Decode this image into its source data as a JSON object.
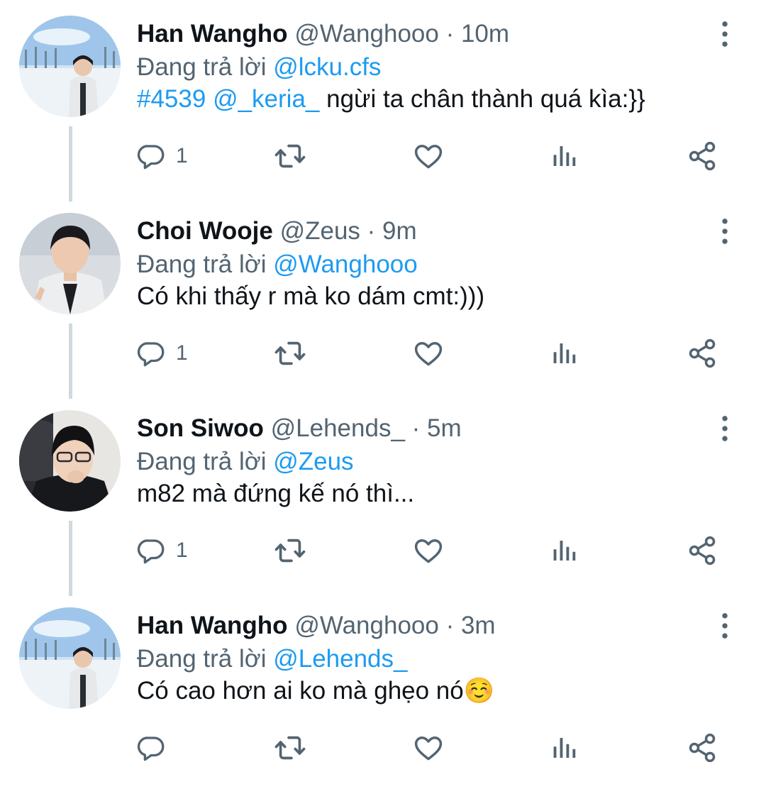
{
  "tweets": [
    {
      "name": "Han Wangho",
      "handle": "@Wanghooo",
      "separator": "·",
      "time": "10m",
      "reply_prefix": "Đang trả lời",
      "reply_to": "@lcku.cfs",
      "hashtag": "#4539",
      "mention": "@_keria_",
      "text": "ngừi ta chân thành quá kìa:}}",
      "reply_count": "1",
      "avatar": "winter-snow-avatar"
    },
    {
      "name": "Choi Wooje",
      "handle": "@Zeus",
      "separator": "·",
      "time": "9m",
      "reply_prefix": "Đang trả lời",
      "reply_to": "@Wanghooo",
      "text": "Có khi thấy r mà ko dám cmt:)))",
      "reply_count": "1",
      "avatar": "snow-portrait-avatar"
    },
    {
      "name": "Son Siwoo",
      "handle": "@Lehends_",
      "separator": "·",
      "time": "5m",
      "reply_prefix": "Đang trả lời",
      "reply_to": "@Zeus",
      "text": "m82 mà đứng kế nó thì...",
      "reply_count": "1",
      "avatar": "gaming-chair-avatar"
    },
    {
      "name": "Han Wangho",
      "handle": "@Wanghooo",
      "separator": "·",
      "time": "3m",
      "reply_prefix": "Đang trả lời",
      "reply_to": "@Lehends_",
      "text": "Có cao hơn ai ko mà ghẹo nó☺️",
      "reply_count": "",
      "avatar": "winter-snow-avatar"
    }
  ],
  "icons": {
    "reply": "reply-icon",
    "retweet": "retweet-icon",
    "like": "heart-icon",
    "views": "views-icon",
    "share": "share-icon",
    "more": "more-vertical-icon"
  },
  "colors": {
    "link": "#1d9bf0",
    "secondary_text": "#536471",
    "primary_text": "#0f1419",
    "icon": "#536471",
    "thread_line": "#cfd9de"
  }
}
